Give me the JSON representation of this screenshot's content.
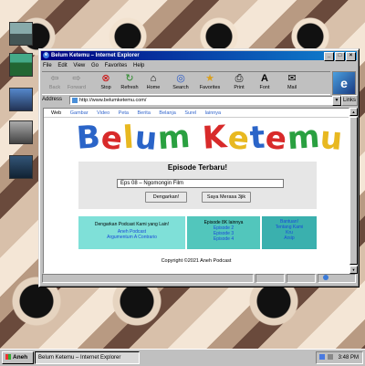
{
  "window": {
    "title": "Belum Ketemu – Internet Explorer",
    "title_icon": "e"
  },
  "menu": {
    "items": [
      "File",
      "Edit",
      "View",
      "Go",
      "Favorites",
      "Help"
    ]
  },
  "toolbar": {
    "buttons": [
      {
        "label": "Back",
        "icon": "back-arrow",
        "glyph": "⇦",
        "disabled": true
      },
      {
        "label": "Forward",
        "icon": "forward-arrow",
        "glyph": "⇨",
        "disabled": true
      },
      {
        "label": "Stop",
        "icon": "stop",
        "glyph": "⊗",
        "disabled": false
      },
      {
        "label": "Refresh",
        "icon": "refresh",
        "glyph": "↻",
        "disabled": false
      },
      {
        "label": "Home",
        "icon": "home",
        "glyph": "⌂",
        "disabled": false
      },
      {
        "label": "Search",
        "icon": "search",
        "glyph": "◎",
        "disabled": false
      },
      {
        "label": "Favorites",
        "icon": "favorites",
        "glyph": "★",
        "disabled": false
      },
      {
        "label": "Print",
        "icon": "print",
        "glyph": "⎙",
        "disabled": false
      },
      {
        "label": "Font",
        "icon": "font",
        "glyph": "A",
        "disabled": false
      },
      {
        "label": "Mail",
        "icon": "mail",
        "glyph": "✉",
        "disabled": false
      }
    ]
  },
  "address": {
    "label": "Address",
    "url": "http://www.belumketemu.com/",
    "links_label": "Links"
  },
  "page": {
    "nav": [
      "Web",
      "Gambar",
      "Video",
      "Peta",
      "Berita",
      "Belanja",
      "Surel",
      "lainnya"
    ],
    "logo_text": "Belum Ketemu",
    "logo_colors": [
      "#2a64c8",
      "#d82a2a",
      "#e8b820",
      "#2a64c8",
      "#2aa040",
      "#d82a2a",
      "#e8b820",
      "#2a64c8",
      "#d82a2a",
      "#2aa040",
      "#e8b820",
      "#2a64c8"
    ],
    "episode": {
      "heading": "Episode Terbaru!",
      "input_value": "Eps 08 – Ngomongin Film",
      "btn_listen": "Dengarkan!",
      "btn_lucky": "Saya Merasa 3jik"
    },
    "panel1": {
      "heading": "Dengarkan Podcast Kami yang Lain!",
      "links": [
        "Aneh Podcast",
        "Argumentum A Contrario"
      ]
    },
    "panel2": {
      "heading": "Episode 8K lainnya",
      "links": [
        "Episode 2",
        "Episode 3",
        "Episode 4"
      ]
    },
    "panel3": {
      "links": [
        "Bantuan!",
        "Tentang Kami",
        "Kru",
        "Arsip"
      ]
    },
    "copyright": "Copyright ©2021 Aneh Podcast"
  },
  "taskbar": {
    "start_label": "Aneh",
    "task_label": "Belum Ketemu – Internet Explorer",
    "clock": "3:48 PM"
  }
}
